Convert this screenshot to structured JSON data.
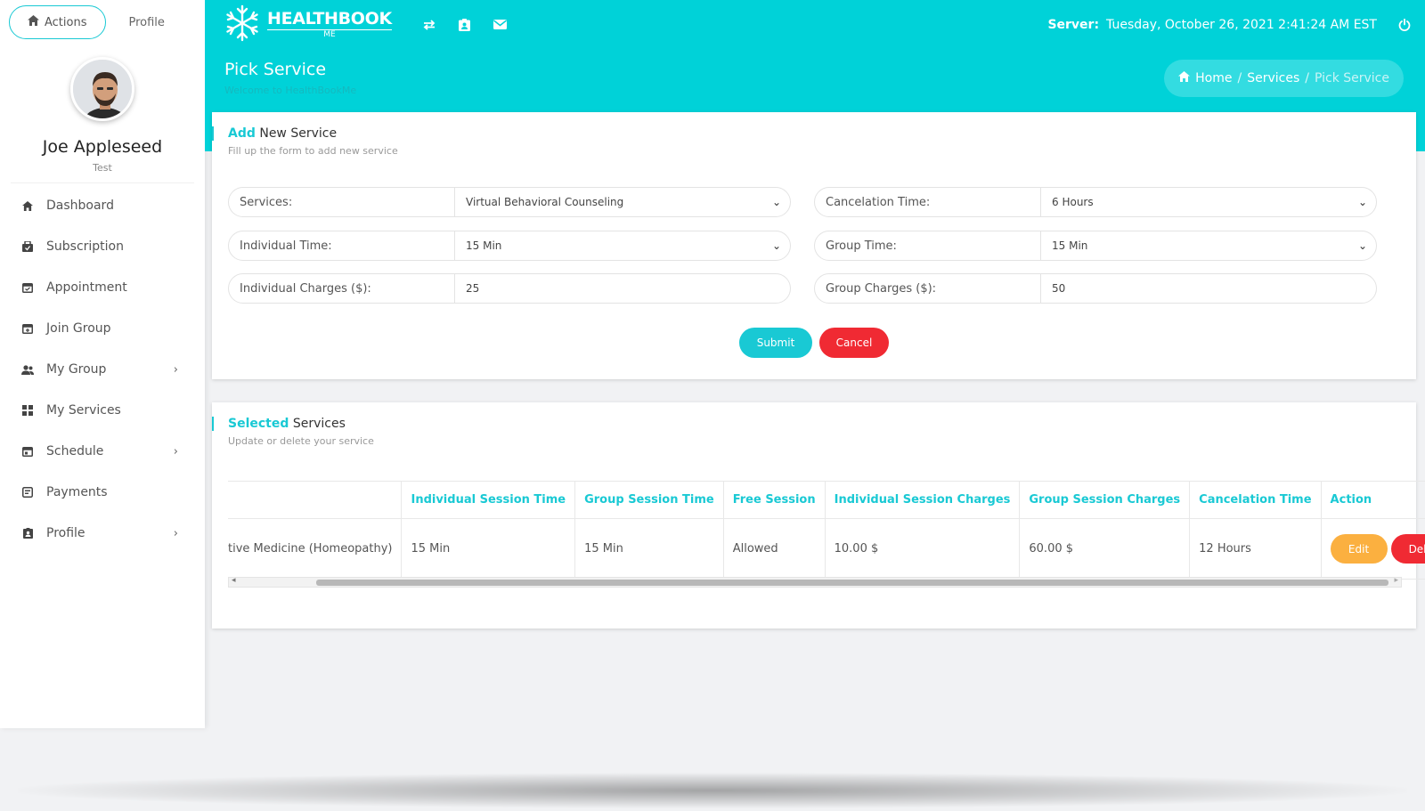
{
  "sidebar": {
    "tabs": {
      "actions": "Actions",
      "profile": "Profile"
    },
    "user": {
      "name": "Joe Appleseed",
      "role": "Test"
    },
    "items": [
      {
        "label": "Dashboard",
        "icon": "home-icon"
      },
      {
        "label": "Subscription",
        "icon": "subscription-icon"
      },
      {
        "label": "Appointment",
        "icon": "calendar-check-icon"
      },
      {
        "label": "Join Group",
        "icon": "calendar-plus-icon"
      },
      {
        "label": "My Group",
        "icon": "users-icon",
        "has_submenu": true
      },
      {
        "label": "My Services",
        "icon": "grid-icon"
      },
      {
        "label": "Schedule",
        "icon": "calendar-icon",
        "has_submenu": true
      },
      {
        "label": "Payments",
        "icon": "receipt-icon"
      },
      {
        "label": "Profile",
        "icon": "id-badge-icon",
        "has_submenu": true
      }
    ]
  },
  "header": {
    "logo_main": "HEALTHBOOK",
    "logo_sub": "ME",
    "server_label": "Server:",
    "server_time": "Tuesday, October 26, 2021 2:41:24 AM EST"
  },
  "page": {
    "title": "Pick Service",
    "subtitle": "Welcome to HealthBookMe",
    "breadcrumb": {
      "home": "Home",
      "services": "Services",
      "current": "Pick Service"
    }
  },
  "add_form": {
    "title_accent": "Add",
    "title_rest": " New Service",
    "subtitle": "Fill up the form to add new service",
    "services": {
      "label": "Services:",
      "value": "Virtual Behavioral Counseling"
    },
    "cancelation_time": {
      "label": "Cancelation Time:",
      "value": "6 Hours"
    },
    "individual_time": {
      "label": "Individual Time:",
      "value": "15 Min"
    },
    "group_time": {
      "label": "Group Time:",
      "value": "15 Min"
    },
    "individual_charges": {
      "label": "Individual Charges ($):",
      "value": "25"
    },
    "group_charges": {
      "label": "Group Charges ($):",
      "value": "50"
    },
    "submit_label": "Submit",
    "cancel_label": "Cancel"
  },
  "selected": {
    "title_accent": "Selected",
    "title_rest": " Services",
    "subtitle": "Update or delete your service",
    "columns": [
      "",
      "Individual Session Time",
      "Group Session Time",
      "Free Session",
      "Individual Session Charges",
      "Group Session Charges",
      "Cancelation Time",
      "Action"
    ],
    "rows": [
      {
        "service": "tive Medicine (Homeopathy)",
        "individual_time": "15 Min",
        "group_time": "15 Min",
        "free_session": "Allowed",
        "individual_charges": "10.00 $",
        "group_charges": "60.00 $",
        "cancelation": "12 Hours",
        "edit_label": "Edit",
        "del_label": "Del"
      }
    ]
  },
  "colors": {
    "accent": "#00d2d8",
    "danger": "#f02a33",
    "warning": "#fbb040"
  }
}
